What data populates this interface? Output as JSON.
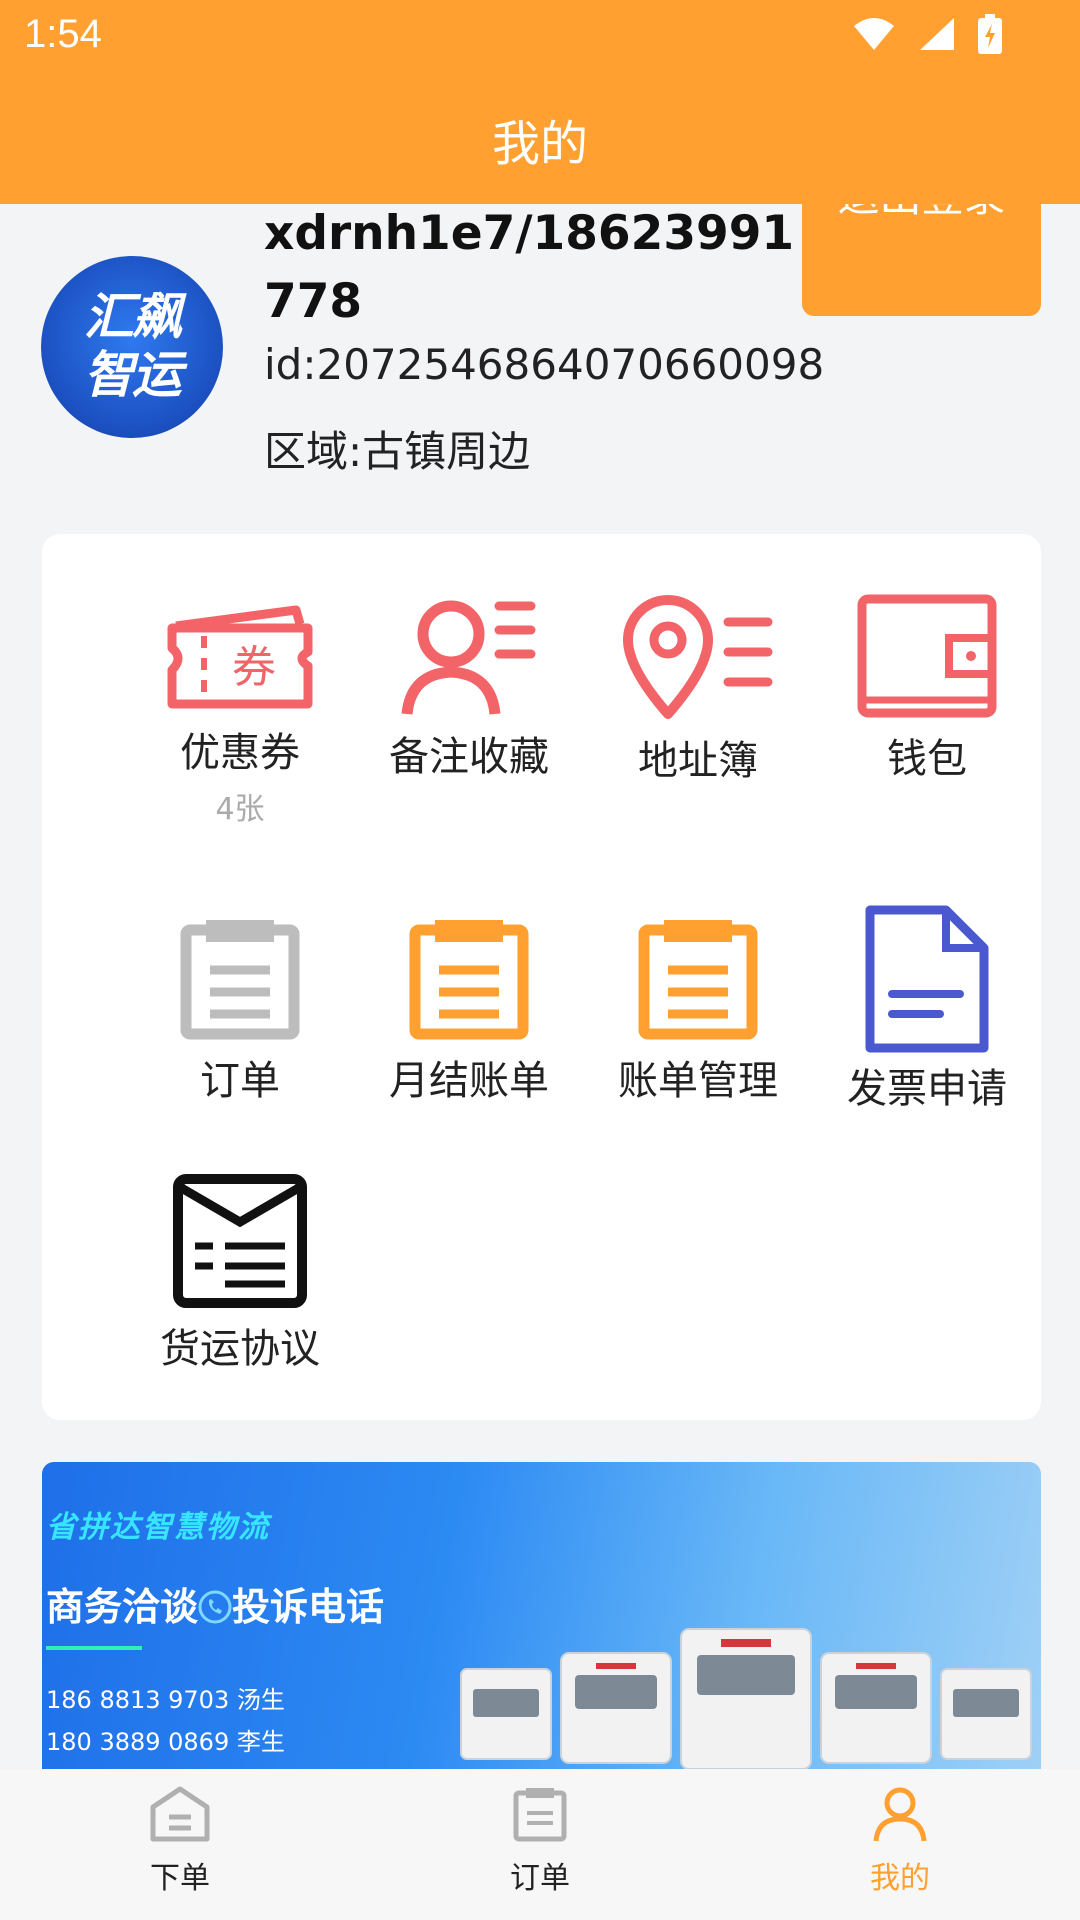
{
  "status": {
    "time": "1:54"
  },
  "header": {
    "title": "我的"
  },
  "profile": {
    "logout_label": "退出登录",
    "avatar_text": "汇飙智运",
    "name": "xdrnh1e7/18623991778",
    "id": "id:2072546864070660098",
    "region": "区域:古镇周边"
  },
  "menu": {
    "coupon": {
      "label": "优惠券",
      "sub": "4张"
    },
    "favorites": {
      "label": "备注收藏"
    },
    "address": {
      "label": "地址簿"
    },
    "wallet": {
      "label": "钱包"
    },
    "orders": {
      "label": "订单"
    },
    "monthly_bill": {
      "label": "月结账单"
    },
    "bill_mgmt": {
      "label": "账单管理"
    },
    "invoice": {
      "label": "发票申请"
    },
    "agreement": {
      "label": "货运协议"
    }
  },
  "banner": {
    "slogan": "省拼达智慧物流",
    "headline_left": "商务洽谈",
    "headline_right": "投诉电话",
    "phone1": "186 8813 9703 汤生",
    "phone2": "180 3889 0869 李生"
  },
  "bottom_nav": {
    "order_place": "下单",
    "orders": "订单",
    "mine": "我的"
  },
  "colors": {
    "accent": "#ffa030",
    "coral": "#f26468",
    "gray_icon": "#bdbdbd",
    "invoice_blue": "#4a59cf"
  }
}
